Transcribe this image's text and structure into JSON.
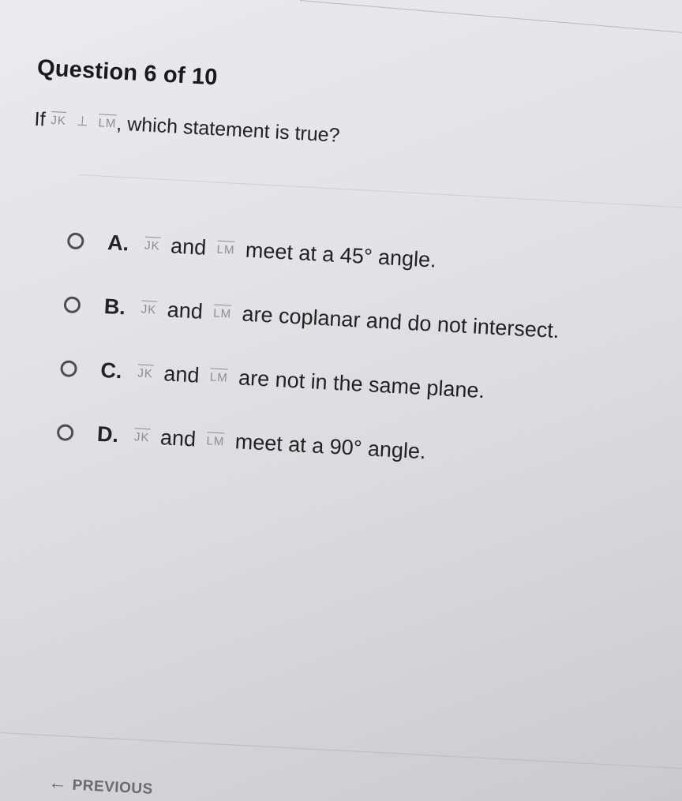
{
  "question": {
    "title": "Question 6 of 10",
    "prefix": "If",
    "segment1": "JK",
    "perp_symbol": "⊥",
    "segment2": "LM",
    "suffix": ", which statement is true?"
  },
  "options": [
    {
      "letter": "A.",
      "seg1": "JK",
      "mid": "and",
      "seg2": "LM",
      "text": "meet at a 45° angle."
    },
    {
      "letter": "B.",
      "seg1": "JK",
      "mid": "and",
      "seg2": "LM",
      "text": "are coplanar and do not intersect."
    },
    {
      "letter": "C.",
      "seg1": "JK",
      "mid": "and",
      "seg2": "LM",
      "text": "are not in the same plane."
    },
    {
      "letter": "D.",
      "seg1": "JK",
      "mid": "and",
      "seg2": "LM",
      "text": "meet at a 90° angle."
    }
  ],
  "footer": {
    "previous_label": "PREVIOUS",
    "previous_icon": "arrow-left-icon"
  }
}
